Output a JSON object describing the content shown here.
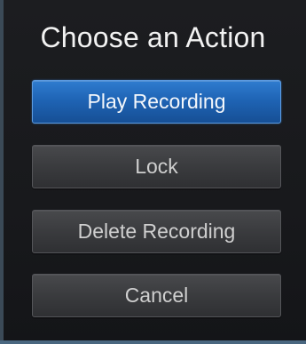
{
  "dialog": {
    "title": "Choose an Action",
    "actions": [
      {
        "label": "Play Recording",
        "selected": true
      },
      {
        "label": "Lock",
        "selected": false
      },
      {
        "label": "Delete Recording",
        "selected": false
      },
      {
        "label": "Cancel",
        "selected": false
      }
    ]
  },
  "colors": {
    "background": "#1a1b1e",
    "selected_button": "#1f64b5",
    "button": "#3a3b3e",
    "title_text": "#f2f2f2",
    "button_text": "#cfcfcf"
  }
}
